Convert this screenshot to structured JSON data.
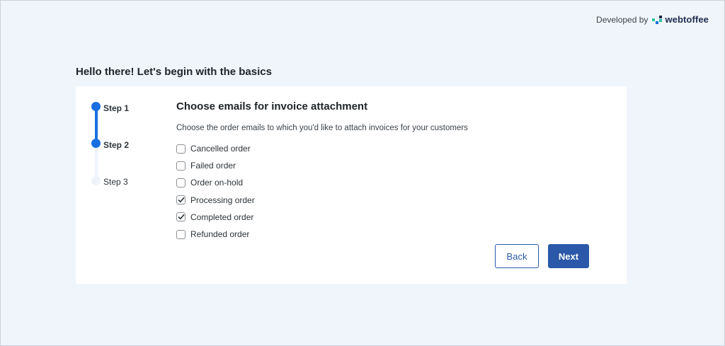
{
  "header": {
    "developed_by": "Developed by",
    "brand_name": "webtoffee",
    "brand_colors": [
      "#2cc2a4",
      "#1a6fe0",
      "#1d2a4d"
    ]
  },
  "page_title": "Hello there! Let's begin with the basics",
  "steps": [
    {
      "label": "Step 1",
      "state": "completed"
    },
    {
      "label": "Step 2",
      "state": "current"
    },
    {
      "label": "Step 3",
      "state": "pending"
    }
  ],
  "main": {
    "title": "Choose emails for invoice attachment",
    "description": "Choose the order emails to which you'd like to attach invoices for your customers",
    "options": [
      {
        "label": "Cancelled order",
        "checked": false
      },
      {
        "label": "Failed order",
        "checked": false
      },
      {
        "label": "Order on-hold",
        "checked": false
      },
      {
        "label": "Processing order",
        "checked": true
      },
      {
        "label": "Completed order",
        "checked": true
      },
      {
        "label": "Refunded order",
        "checked": false
      }
    ]
  },
  "actions": {
    "back_label": "Back",
    "next_label": "Next"
  },
  "colors": {
    "accent": "#1a6fe0",
    "button_primary": "#2b58a8",
    "background": "#f0f5fc"
  }
}
